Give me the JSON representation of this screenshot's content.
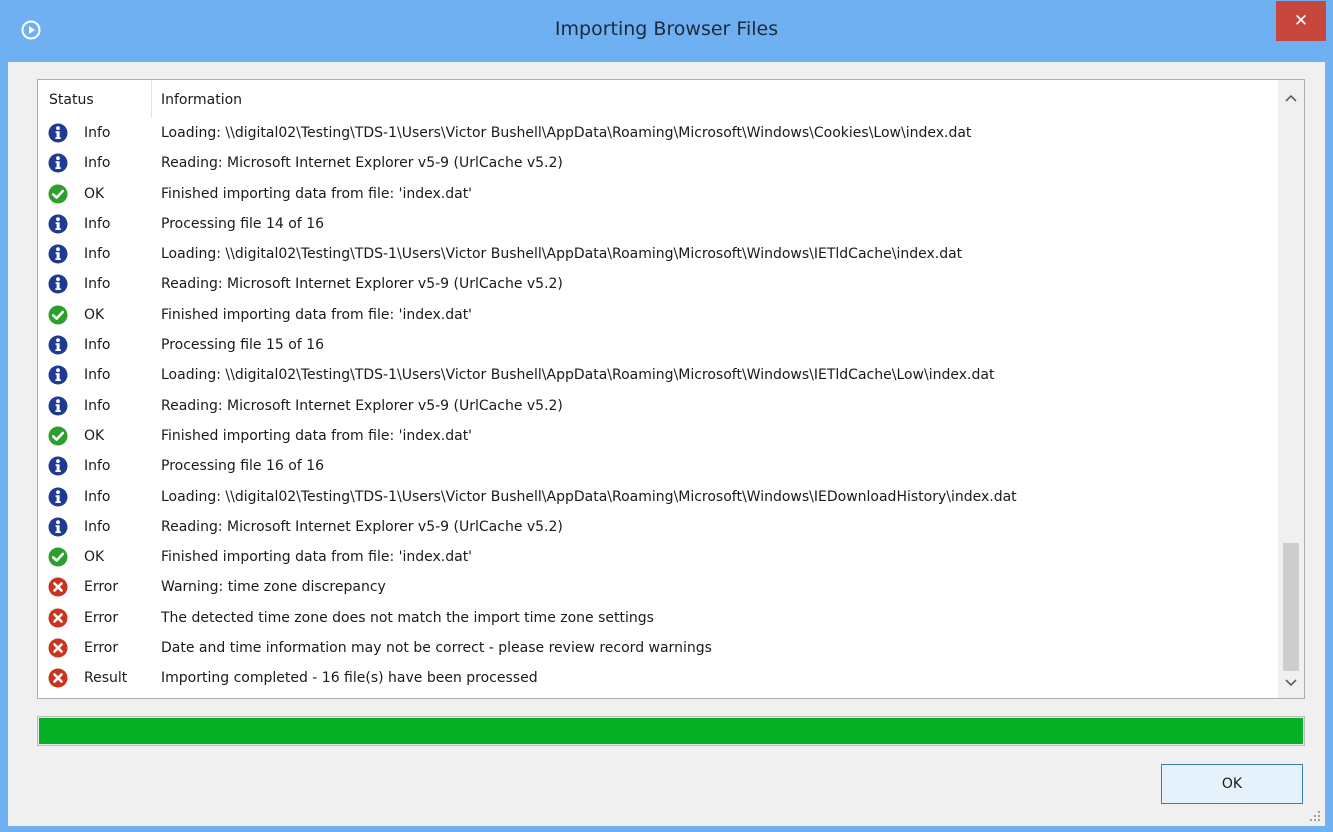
{
  "window": {
    "title": "Importing Browser Files",
    "close_label": "✕"
  },
  "list": {
    "headers": {
      "status": "Status",
      "information": "Information"
    },
    "rows": [
      {
        "icon": "info-icon",
        "status": "Info",
        "information": "Loading: \\\\digital02\\Testing\\TDS-1\\Users\\Victor Bushell\\AppData\\Roaming\\Microsoft\\Windows\\Cookies\\Low\\index.dat"
      },
      {
        "icon": "info-icon",
        "status": "Info",
        "information": "Reading: Microsoft Internet Explorer v5-9 (UrlCache v5.2)"
      },
      {
        "icon": "ok-icon",
        "status": "OK",
        "information": "Finished importing data from file: 'index.dat'"
      },
      {
        "icon": "info-icon",
        "status": "Info",
        "information": "Processing file 14 of 16"
      },
      {
        "icon": "info-icon",
        "status": "Info",
        "information": "Loading: \\\\digital02\\Testing\\TDS-1\\Users\\Victor Bushell\\AppData\\Roaming\\Microsoft\\Windows\\IETldCache\\index.dat"
      },
      {
        "icon": "info-icon",
        "status": "Info",
        "information": "Reading: Microsoft Internet Explorer v5-9 (UrlCache v5.2)"
      },
      {
        "icon": "ok-icon",
        "status": "OK",
        "information": "Finished importing data from file: 'index.dat'"
      },
      {
        "icon": "info-icon",
        "status": "Info",
        "information": "Processing file 15 of 16"
      },
      {
        "icon": "info-icon",
        "status": "Info",
        "information": "Loading: \\\\digital02\\Testing\\TDS-1\\Users\\Victor Bushell\\AppData\\Roaming\\Microsoft\\Windows\\IETldCache\\Low\\index.dat"
      },
      {
        "icon": "info-icon",
        "status": "Info",
        "information": "Reading: Microsoft Internet Explorer v5-9 (UrlCache v5.2)"
      },
      {
        "icon": "ok-icon",
        "status": "OK",
        "information": "Finished importing data from file: 'index.dat'"
      },
      {
        "icon": "info-icon",
        "status": "Info",
        "information": "Processing file 16 of 16"
      },
      {
        "icon": "info-icon",
        "status": "Info",
        "information": "Loading: \\\\digital02\\Testing\\TDS-1\\Users\\Victor Bushell\\AppData\\Roaming\\Microsoft\\Windows\\IEDownloadHistory\\index.dat"
      },
      {
        "icon": "info-icon",
        "status": "Info",
        "information": "Reading: Microsoft Internet Explorer v5-9 (UrlCache v5.2)"
      },
      {
        "icon": "ok-icon",
        "status": "OK",
        "information": "Finished importing data from file: 'index.dat'"
      },
      {
        "icon": "error-icon",
        "status": "Error",
        "information": "Warning: time zone discrepancy"
      },
      {
        "icon": "error-icon",
        "status": "Error",
        "information": "The detected time zone does not match the import time zone settings"
      },
      {
        "icon": "error-icon",
        "status": "Error",
        "information": "Date and time information may not be correct - please review record warnings"
      },
      {
        "icon": "error-icon",
        "status": "Result",
        "information": "Importing completed - 16 file(s) have been processed"
      }
    ]
  },
  "progress": {
    "value_percent": 100
  },
  "buttons": {
    "ok_label": "OK"
  },
  "colors": {
    "info": "#1f3a93",
    "ok": "#2e9e2e",
    "error": "#c8341d",
    "progress": "#06b025",
    "close": "#c7463e"
  }
}
